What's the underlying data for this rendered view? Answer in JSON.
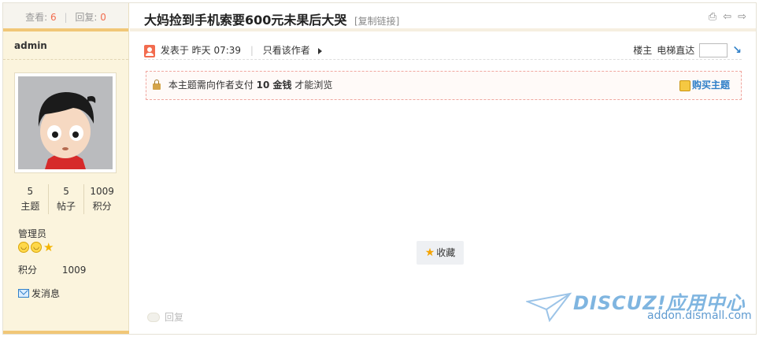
{
  "stats": {
    "views_label": "查看:",
    "views": "6",
    "replies_label": "回复:",
    "replies": "0"
  },
  "author": {
    "name": "admin",
    "topics": "5",
    "topics_label": "主题",
    "posts": "5",
    "posts_label": "帖子",
    "credits": "1009",
    "credits_label": "积分",
    "group": "管理员",
    "points_label": "积分",
    "points": "1009",
    "pm_label": "发消息"
  },
  "thread": {
    "title": "大妈捡到手机索要600元未果后大哭",
    "copy_link": "[复制链接]"
  },
  "meta": {
    "posted_label": "发表于 昨天",
    "time": "07:39",
    "only_author": "只看该作者",
    "floor": "楼主",
    "jump_label": "电梯直达"
  },
  "paywall": {
    "prefix": "本主题需向作者支付",
    "amount": "10 金钱",
    "suffix": "才能浏览",
    "buy_label": "购买主题"
  },
  "actions": {
    "favorite": "收藏",
    "reply": "回复"
  },
  "watermark": {
    "brand": "DISCUZ!应用中心",
    "url": "addon.dismall.com"
  },
  "colors": {
    "accent_orange": "#f1c777",
    "link_blue": "#2f7fc8",
    "count_red": "#f26c4f"
  }
}
